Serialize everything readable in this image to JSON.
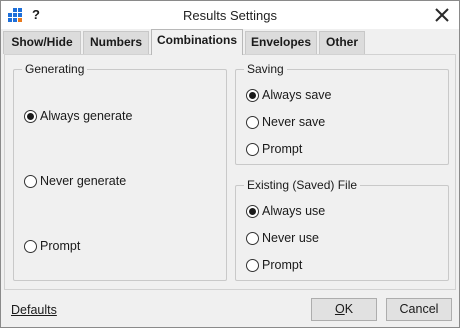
{
  "window": {
    "title": "Results Settings",
    "help_label": "?"
  },
  "tabs": [
    {
      "label": "Show/Hide",
      "active": false
    },
    {
      "label": "Numbers",
      "active": false
    },
    {
      "label": "Combinations",
      "active": true
    },
    {
      "label": "Envelopes",
      "active": false
    },
    {
      "label": "Other",
      "active": false
    }
  ],
  "generating": {
    "legend": "Generating",
    "options": [
      {
        "label": "Always generate",
        "checked": true
      },
      {
        "label": "Never generate",
        "checked": false
      },
      {
        "label": "Prompt",
        "checked": false
      }
    ]
  },
  "saving": {
    "legend": "Saving",
    "options": [
      {
        "label": "Always save",
        "checked": true
      },
      {
        "label": "Never save",
        "checked": false
      },
      {
        "label": "Prompt",
        "checked": false
      }
    ]
  },
  "existing_file": {
    "legend": "Existing (Saved) File",
    "options": [
      {
        "label": "Always use",
        "checked": true
      },
      {
        "label": "Never use",
        "checked": false
      },
      {
        "label": "Prompt",
        "checked": false
      }
    ]
  },
  "footer": {
    "defaults_label": "Defaults",
    "ok_mnemonic": "O",
    "ok_rest": "K",
    "cancel_label": "Cancel"
  },
  "icons": {
    "app": "app-grid-icon",
    "close": "close-icon"
  },
  "colors": {
    "accent": "#1e6fd9"
  }
}
